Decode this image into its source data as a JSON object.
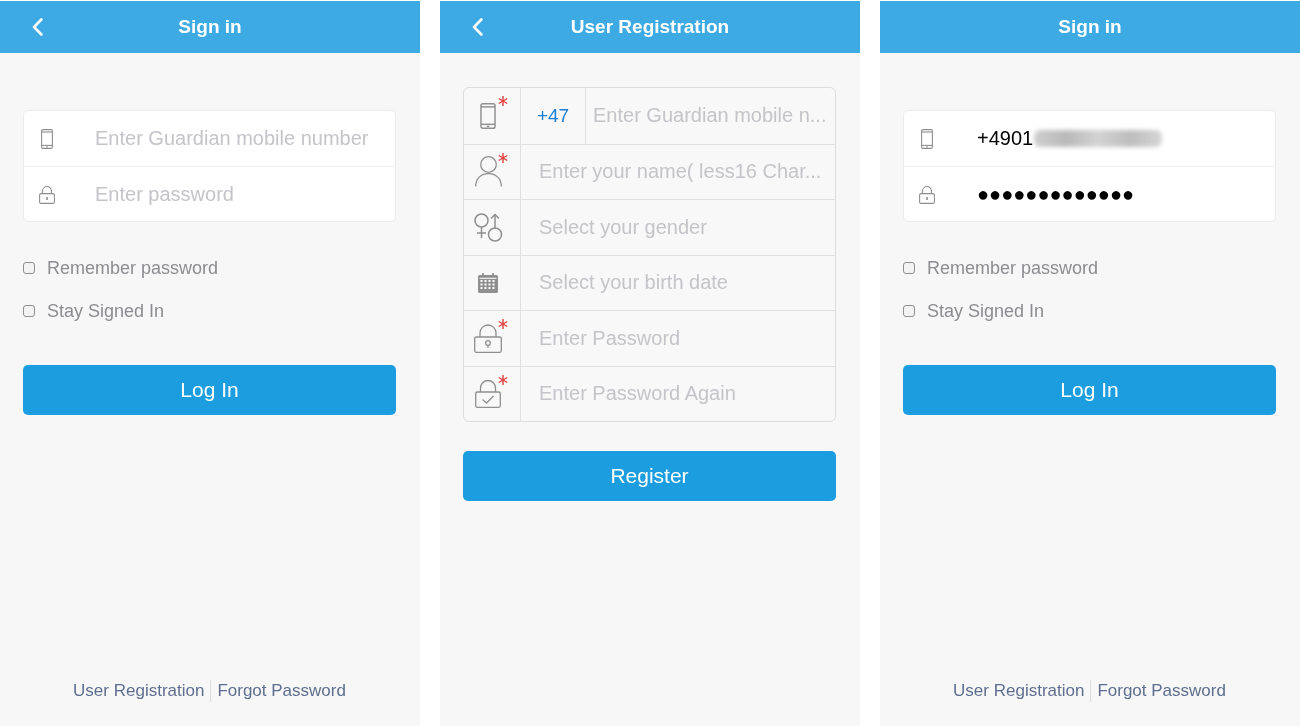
{
  "screens": [
    {
      "kind": "sign_in",
      "header": {
        "back": true,
        "title": "Sign in"
      },
      "fields": [
        {
          "kind": "phone",
          "placeholder": "Enter Guardian mobile number"
        },
        {
          "kind": "password",
          "placeholder": "Enter password"
        }
      ],
      "options": [
        {
          "label": "Remember password",
          "checked": false
        },
        {
          "label": "Stay Signed In",
          "checked": false
        }
      ],
      "button": "Log In",
      "links": [
        "User Registration",
        "Forgot Password"
      ]
    },
    {
      "kind": "registration",
      "header": {
        "back": true,
        "title": "User Registration"
      },
      "fields": [
        {
          "kind": "phone",
          "required": true,
          "prefix": "+47",
          "placeholder": "Enter Guardian mobile n..."
        },
        {
          "kind": "name",
          "required": true,
          "placeholder": "Enter your name( less16 Char..."
        },
        {
          "kind": "gender",
          "required": false,
          "placeholder": "Select your gender"
        },
        {
          "kind": "birth_date",
          "required": false,
          "placeholder": "Select your birth date"
        },
        {
          "kind": "password",
          "required": true,
          "placeholder": "Enter Password"
        },
        {
          "kind": "confirm_password",
          "required": true,
          "placeholder": "Enter Password Again"
        }
      ],
      "button": "Register"
    },
    {
      "kind": "sign_in",
      "header": {
        "back": false,
        "title": "Sign in"
      },
      "fields": [
        {
          "kind": "phone",
          "value": "+4901",
          "redacted": true
        },
        {
          "kind": "password",
          "value": "●●●●●●●●●●●●●"
        }
      ],
      "options": [
        {
          "label": "Remember password",
          "checked": false
        },
        {
          "label": "Stay Signed In",
          "checked": false
        }
      ],
      "button": "Log In",
      "links": [
        "User Registration",
        "Forgot Password"
      ]
    }
  ]
}
